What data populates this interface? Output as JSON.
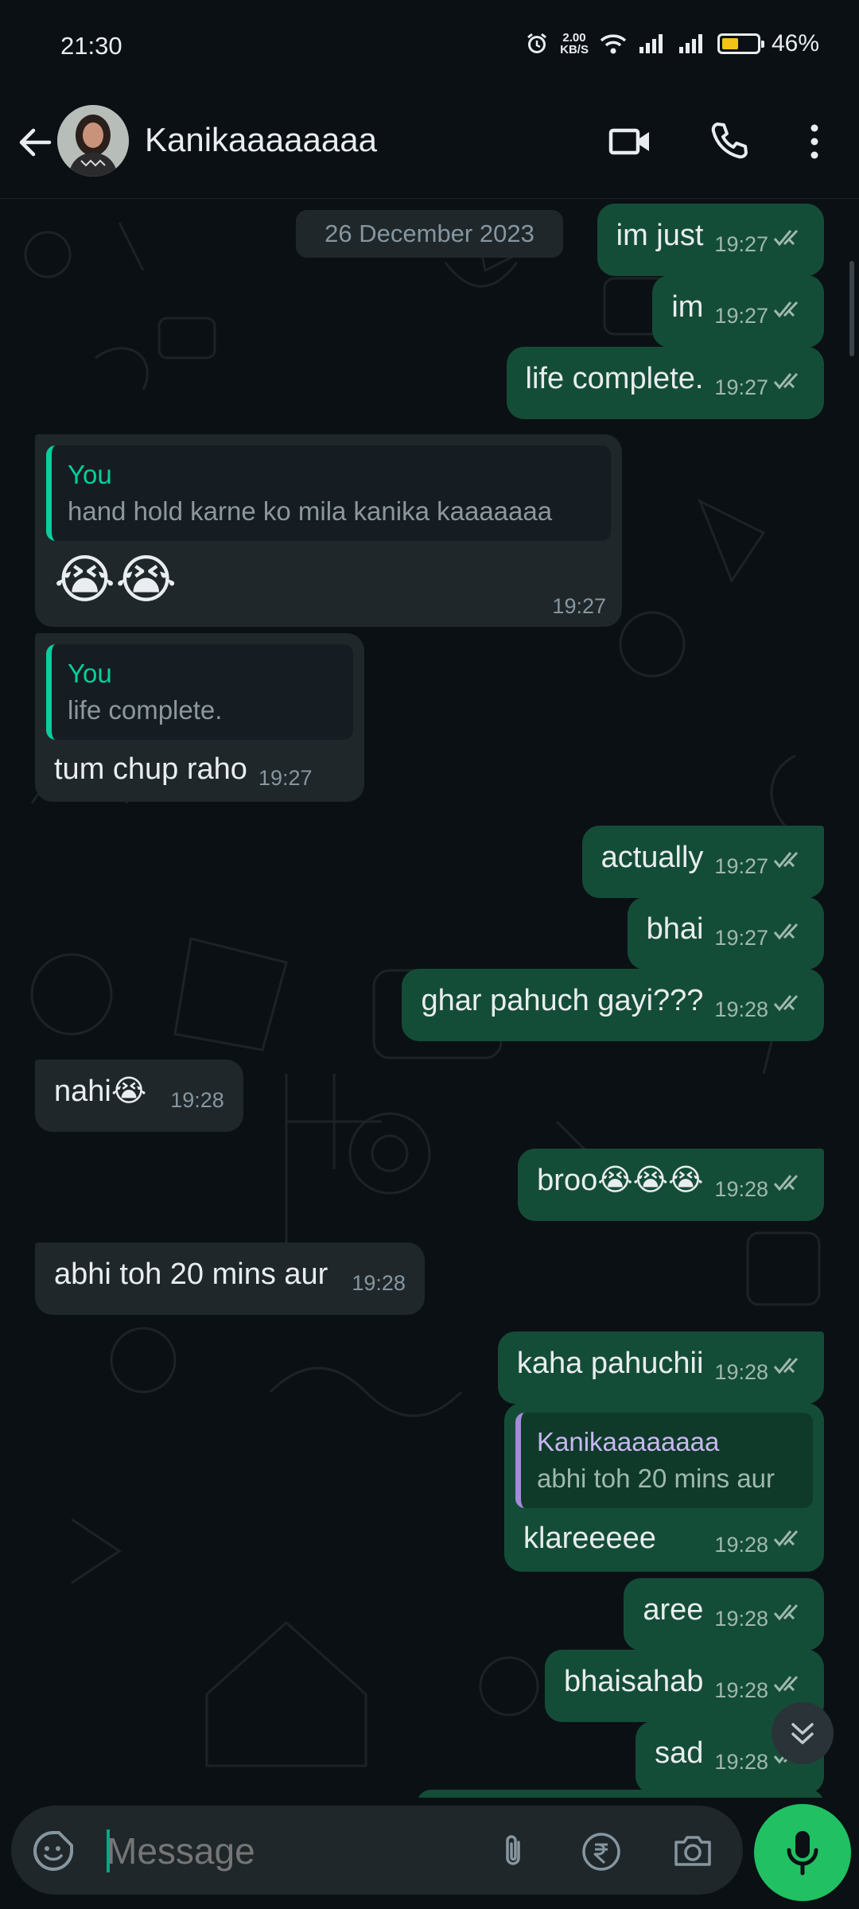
{
  "status_bar": {
    "time": "21:30",
    "speed_top": "2.00",
    "speed_bottom": "KB/S",
    "battery": "46%",
    "battery_color": "#f3c318"
  },
  "header": {
    "contact_name": "Kanikaaaaaaaa"
  },
  "chat": {
    "date_chip": "26 December 2023",
    "messages": [
      {
        "dir": "out",
        "text": "im just",
        "time": "19:27",
        "ticks": "read"
      },
      {
        "dir": "out",
        "text": "im",
        "time": "19:27",
        "ticks": "read"
      },
      {
        "dir": "out",
        "text": "life complete.",
        "time": "19:27",
        "ticks": "read"
      },
      {
        "dir": "in",
        "quote_name": "You",
        "quote_text": "hand hold karne ko mila kanika kaaaaaaa",
        "text": "😭😭",
        "time": "19:27"
      },
      {
        "dir": "in",
        "quote_name": "You",
        "quote_text": "life complete.",
        "text": "tum chup raho",
        "time": "19:27"
      },
      {
        "dir": "out",
        "text": "actually",
        "time": "19:27",
        "ticks": "read"
      },
      {
        "dir": "out",
        "text": "bhai",
        "time": "19:27",
        "ticks": "read"
      },
      {
        "dir": "out",
        "text": "ghar pahuch gayi???",
        "time": "19:28",
        "ticks": "read"
      },
      {
        "dir": "in",
        "text": "nahi😭",
        "time": "19:28"
      },
      {
        "dir": "out",
        "text": "broo😭😭😭",
        "time": "19:28",
        "ticks": "read"
      },
      {
        "dir": "in",
        "text": "abhi toh 20 mins aur",
        "time": "19:28"
      },
      {
        "dir": "out",
        "text": "kaha pahuchii",
        "time": "19:28",
        "ticks": "read"
      },
      {
        "dir": "out",
        "quote_name": "Kanikaaaaaaaa",
        "quote_text": "abhi toh 20 mins aur",
        "text": "klareeeee",
        "time": "19:28",
        "ticks": "read"
      },
      {
        "dir": "out",
        "text": "aree",
        "time": "19:28",
        "ticks": "read"
      },
      {
        "dir": "out",
        "text": "bhaisahab",
        "time": "19:28",
        "ticks": "read"
      },
      {
        "dir": "out",
        "text": "sad",
        "time": "19:28",
        "ticks": "read"
      }
    ]
  },
  "input": {
    "placeholder": "Message"
  },
  "icons": [
    "back-arrow-icon",
    "video-call-icon",
    "voice-call-icon",
    "more-options-icon",
    "sticker-icon",
    "attach-icon",
    "rupee-payment-icon",
    "camera-icon",
    "mic-icon",
    "scroll-down-icon",
    "double-check-icon",
    "alarm-icon",
    "wifi-icon",
    "signal-icon",
    "battery-icon"
  ],
  "colors": {
    "outgoing_bubble": "#144d37",
    "incoming_bubble": "#1f272a",
    "accent": "#21c063",
    "quote_bar_in": "#06cf9c",
    "quote_bar_out": "#a58bd9"
  }
}
